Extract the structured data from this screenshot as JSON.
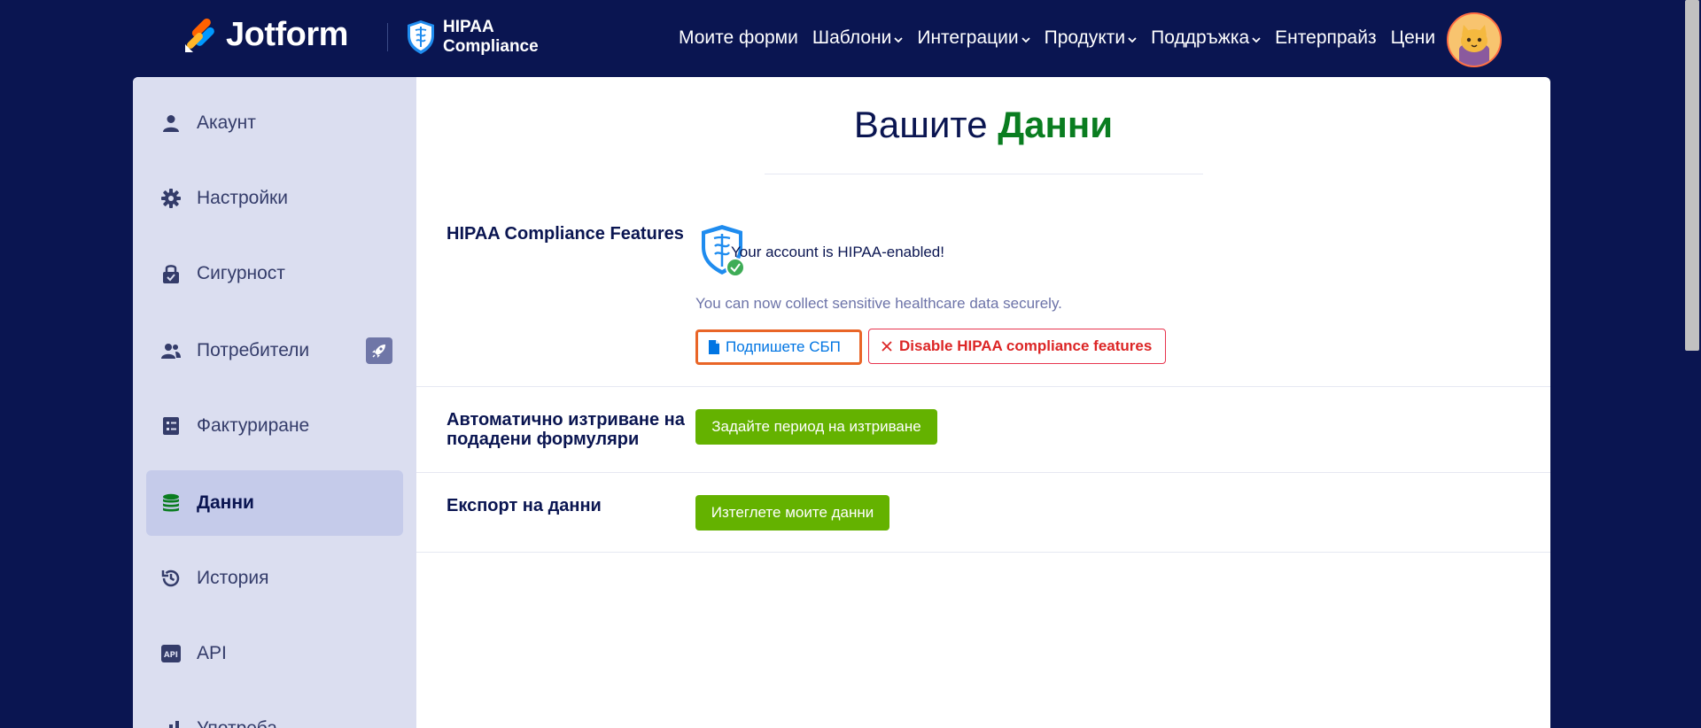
{
  "header": {
    "brand": "Jotform",
    "hipaa_badge_line1": "HIPAA",
    "hipaa_badge_line2": "Compliance",
    "nav": [
      {
        "label": "Моите форми",
        "has_dropdown": false
      },
      {
        "label": "Шаблони",
        "has_dropdown": true
      },
      {
        "label": "Интеграции",
        "has_dropdown": true
      },
      {
        "label": "Продукти",
        "has_dropdown": true
      },
      {
        "label": "Поддръжка",
        "has_dropdown": true
      },
      {
        "label": "Ентерпрайз",
        "has_dropdown": false
      },
      {
        "label": "Цени",
        "has_dropdown": false
      }
    ]
  },
  "sidebar": {
    "items": [
      {
        "label": "Акаунт",
        "icon": "user-icon",
        "active": false
      },
      {
        "label": "Настройки",
        "icon": "gear-icon",
        "active": false
      },
      {
        "label": "Сигурност",
        "icon": "lock-icon",
        "active": false
      },
      {
        "label": "Потребители",
        "icon": "users-icon",
        "active": false,
        "badge_icon": "rocket-icon"
      },
      {
        "label": "Фактуриране",
        "icon": "invoice-icon",
        "active": false
      },
      {
        "label": "Данни",
        "icon": "database-icon",
        "active": true
      },
      {
        "label": "История",
        "icon": "history-icon",
        "active": false
      },
      {
        "label": "API",
        "icon": "api-icon",
        "active": false
      },
      {
        "label": "Употреба",
        "icon": "usage-icon",
        "active": false
      }
    ]
  },
  "main": {
    "title_prefix": "Вашите",
    "title_highlight": "Данни",
    "hipaa": {
      "label": "HIPAA Compliance Features",
      "status": "Your account is HIPAA-enabled!",
      "description": "You can now collect sensitive healthcare data securely.",
      "sign_button": "Подпишете СБП",
      "disable_button": "Disable HIPAA compliance features"
    },
    "auto_delete": {
      "label_line1": "Автоматично изтриване на",
      "label_line2": "подадени формуляри",
      "button": "Задайте период на изтриване"
    },
    "export": {
      "label": "Експорт на данни",
      "button": "Изтеглете моите данни"
    }
  },
  "colors": {
    "nav_bg": "#0a1551",
    "sidebar_bg": "#dbdef0",
    "sidebar_active_bg": "#c5cbea",
    "accent_green": "#64b200",
    "title_green": "#0a7d20",
    "danger_red": "#dc2626",
    "link_blue": "#0075e3",
    "focus_orange": "#e96527"
  }
}
